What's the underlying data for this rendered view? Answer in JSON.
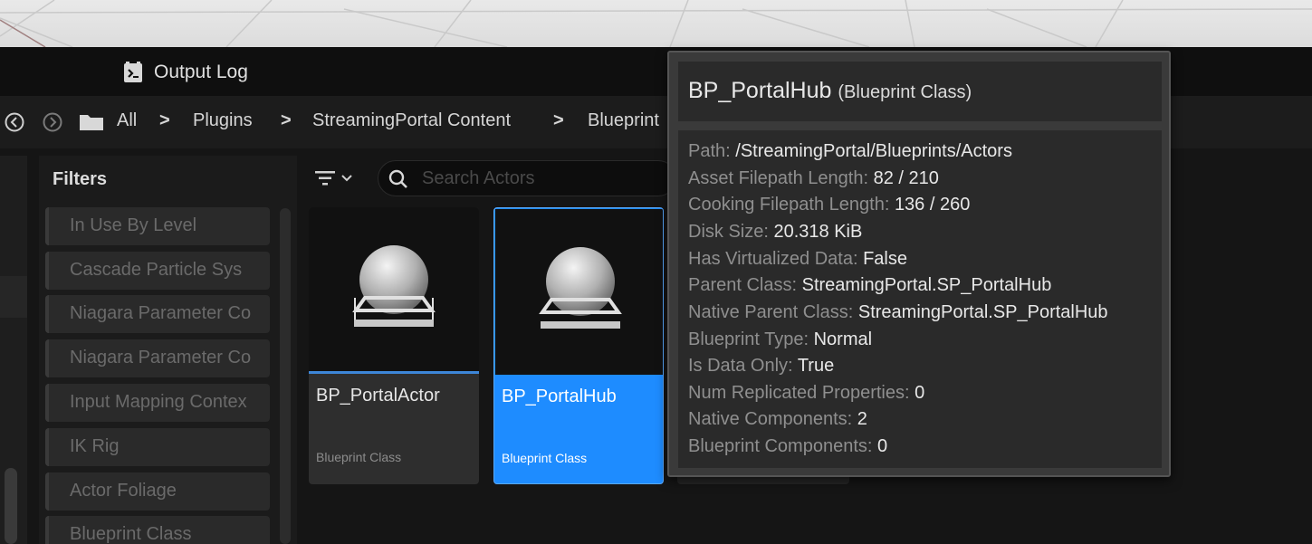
{
  "tabs": {
    "output_log": "Output Log"
  },
  "breadcrumbs": [
    "All",
    "Plugins",
    "StreamingPortal Content",
    "Blueprint"
  ],
  "filters": {
    "title": "Filters",
    "items": [
      "In Use By Level",
      "Cascade Particle Sys",
      "Niagara Parameter Co",
      "Niagara Parameter Co",
      "Input Mapping Contex",
      "IK Rig",
      "Actor Foliage",
      "Blueprint Class"
    ]
  },
  "search": {
    "placeholder": "Search Actors"
  },
  "assets": [
    {
      "name": "BP_PortalActor",
      "type": "Blueprint Class"
    },
    {
      "name": "BP_PortalHub",
      "type": "Blueprint Class"
    }
  ],
  "tooltip": {
    "title": "BP_PortalHub",
    "subtitle": "(Blueprint Class)",
    "rows": [
      {
        "key": "Path:",
        "value": "/StreamingPortal/Blueprints/Actors"
      },
      {
        "key": "Asset Filepath Length:",
        "value": "82 / 210"
      },
      {
        "key": "Cooking Filepath Length:",
        "value": "136 / 260"
      },
      {
        "key": "Disk Size:",
        "value": "20.318 KiB"
      },
      {
        "key": "Has Virtualized Data:",
        "value": "False"
      },
      {
        "key": "Parent Class:",
        "value": "StreamingPortal.SP_PortalHub"
      },
      {
        "key": "Native Parent Class:",
        "value": "StreamingPortal.SP_PortalHub"
      },
      {
        "key": "Blueprint Type:",
        "value": "Normal"
      },
      {
        "key": "Is Data Only:",
        "value": "True"
      },
      {
        "key": "Num Replicated Properties:",
        "value": "0"
      },
      {
        "key": "Native Components:",
        "value": "2"
      },
      {
        "key": "Blueprint Components:",
        "value": "0"
      }
    ]
  },
  "colors": {
    "selection": "#1e8cff",
    "accent_underline": "#3d86d8"
  }
}
